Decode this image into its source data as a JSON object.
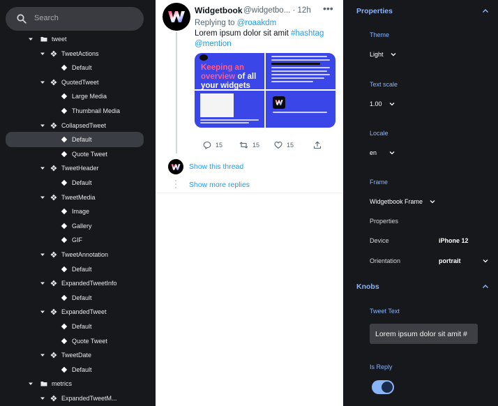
{
  "search": {
    "placeholder": "Search"
  },
  "tree": [
    {
      "label": "tweet",
      "kind": "folder",
      "depth": 0,
      "expanded": true
    },
    {
      "label": "TweetActions",
      "kind": "component",
      "depth": 1,
      "expanded": true
    },
    {
      "label": "Default",
      "kind": "usecase",
      "depth": 2
    },
    {
      "label": "QuotedTweet",
      "kind": "component",
      "depth": 1,
      "expanded": true
    },
    {
      "label": "Large Media",
      "kind": "usecase",
      "depth": 2
    },
    {
      "label": "Thumbnail Media",
      "kind": "usecase",
      "depth": 2
    },
    {
      "label": "CollapsedTweet",
      "kind": "component",
      "depth": 1,
      "expanded": true
    },
    {
      "label": "Default",
      "kind": "usecase",
      "depth": 2,
      "selected": true
    },
    {
      "label": "Quote Tweet",
      "kind": "usecase",
      "depth": 2
    },
    {
      "label": "TweetHeader",
      "kind": "component",
      "depth": 1,
      "expanded": true
    },
    {
      "label": "Default",
      "kind": "usecase",
      "depth": 2
    },
    {
      "label": "TweetMedia",
      "kind": "component",
      "depth": 1,
      "expanded": true
    },
    {
      "label": "Image",
      "kind": "usecase",
      "depth": 2
    },
    {
      "label": "Gallery",
      "kind": "usecase",
      "depth": 2
    },
    {
      "label": "GIF",
      "kind": "usecase",
      "depth": 2
    },
    {
      "label": "TweetAnnotation",
      "kind": "component",
      "depth": 1,
      "expanded": true
    },
    {
      "label": "Default",
      "kind": "usecase",
      "depth": 2
    },
    {
      "label": "ExpandedTweetInfo",
      "kind": "component",
      "depth": 1,
      "expanded": true
    },
    {
      "label": "Default",
      "kind": "usecase",
      "depth": 2
    },
    {
      "label": "ExpandedTweet",
      "kind": "component",
      "depth": 1,
      "expanded": true
    },
    {
      "label": "Default",
      "kind": "usecase",
      "depth": 2
    },
    {
      "label": "Quote Tweet",
      "kind": "usecase",
      "depth": 2
    },
    {
      "label": "TweetDate",
      "kind": "component",
      "depth": 1,
      "expanded": true
    },
    {
      "label": "Default",
      "kind": "usecase",
      "depth": 2
    },
    {
      "label": "metrics",
      "kind": "folder",
      "depth": 0,
      "expanded": true
    },
    {
      "label": "ExpandedTweetM...",
      "kind": "component",
      "depth": 1,
      "expanded": true
    }
  ],
  "tweet": {
    "name": "Widgetbook",
    "handle": "@widgetbo...",
    "time": "· 12h",
    "more": "•••",
    "replying_prefix": "Replying to ",
    "replying_handle": "@roaakdm",
    "text_plain": "Lorem ipsum dolor sit amit ",
    "hashtag": "#hashtag",
    "mention": "@mention",
    "media": {
      "headline_a": "Keeping an",
      "headline_b": "overview",
      "headline_c": " of all",
      "headline_d": "your widgets"
    },
    "replies": "15",
    "retweets": "15",
    "likes": "15",
    "show_thread": "Show this thread",
    "show_replies": "Show more replies"
  },
  "properties": {
    "header": "Properties",
    "theme_label": "Theme",
    "theme_value": "Light",
    "text_scale_label": "Text scale",
    "text_scale_value": "1.00",
    "locale_label": "Locale",
    "locale_value": "en",
    "frame_label": "Frame",
    "frame_value": "Widgetbook Frame",
    "frame_props_label": "Properties",
    "device_label": "Device",
    "device_value": "iPhone 12",
    "orientation_label": "Orientation",
    "orientation_value": "portrait"
  },
  "knobs": {
    "header": "Knobs",
    "tweet_text_label": "Tweet Text",
    "tweet_text_value": "Lorem ipsum dolor sit amit #",
    "is_reply_label": "Is Reply",
    "is_reply_value": true
  },
  "colors": {
    "accent": "#8ab4f8",
    "link": "#1d9bf0",
    "media_blue": "#3a46e8",
    "media_pink": "#ff5a8a"
  }
}
